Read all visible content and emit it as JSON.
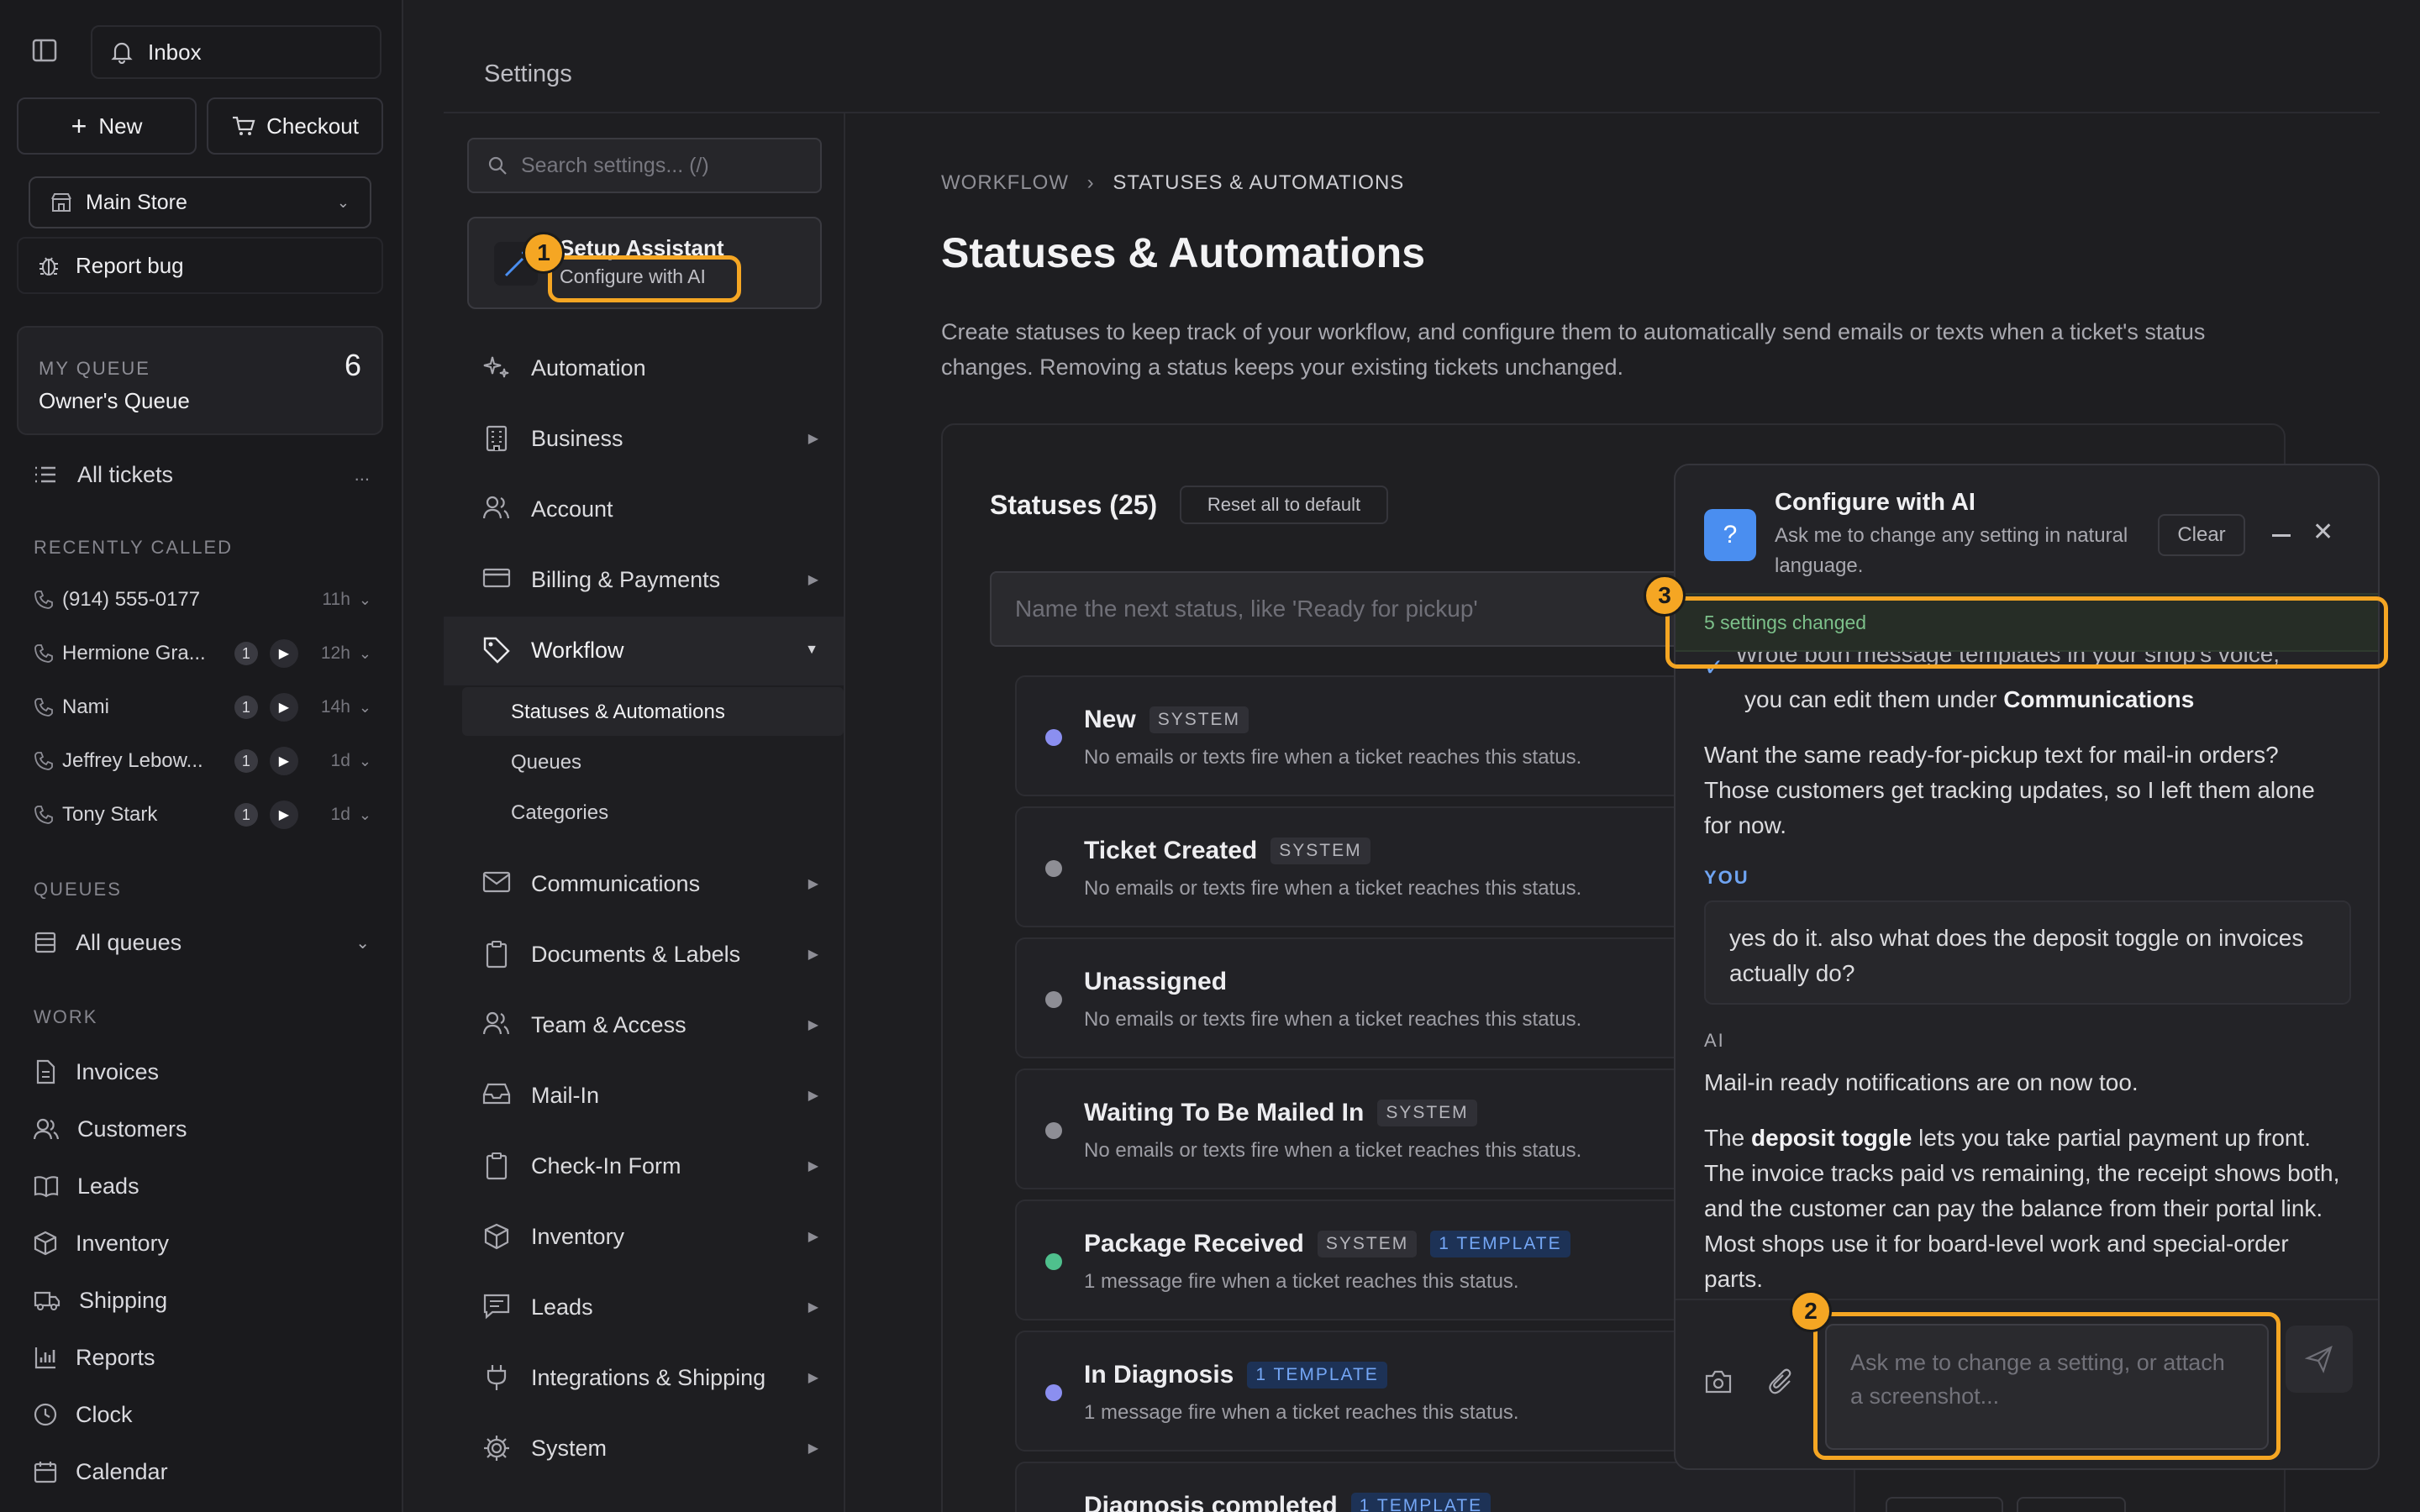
{
  "sidebar": {
    "inbox": "Inbox",
    "new_label": "New",
    "checkout_label": "Checkout",
    "store": "Main Store",
    "report_bug": "Report bug",
    "my_queue_label": "MY QUEUE",
    "my_queue_name": "Owner's Queue",
    "my_queue_count": "6",
    "all_tickets": "All tickets",
    "all_tickets_more": "...",
    "recently_called_label": "RECENTLY CALLED",
    "calls": [
      {
        "name": "(914) 555-0177",
        "badge": "",
        "time": "11h"
      },
      {
        "name": "Hermione Gra...",
        "badge": "1",
        "time": "12h"
      },
      {
        "name": "Nami",
        "badge": "1",
        "time": "14h"
      },
      {
        "name": "Jeffrey Lebow...",
        "badge": "1",
        "time": "1d"
      },
      {
        "name": "Tony Stark",
        "badge": "1",
        "time": "1d"
      }
    ],
    "queues_label": "QUEUES",
    "all_queues": "All queues",
    "work_label": "WORK",
    "work_items": [
      "Invoices",
      "Customers",
      "Leads",
      "Inventory",
      "Shipping",
      "Reports",
      "Clock",
      "Calendar"
    ]
  },
  "settings": {
    "title": "Settings",
    "search_placeholder": "Search settings... (/)",
    "setup_title": "Setup Assistant",
    "setup_sub": "Configure with AI",
    "menu": [
      "Automation",
      "Business",
      "Account",
      "Billing & Payments",
      "Workflow",
      "Communications",
      "Documents & Labels",
      "Team & Access",
      "Mail-In",
      "Check-In Form",
      "Inventory",
      "Leads",
      "Integrations & Shipping",
      "System"
    ],
    "workflow_sub": [
      "Statuses & Automations",
      "Queues",
      "Categories"
    ]
  },
  "main": {
    "crumb_1": "WORKFLOW",
    "crumb_sep": "›",
    "crumb_2": "STATUSES & AUTOMATIONS",
    "title": "Statuses & Automations",
    "description": "Create statuses to keep track of your workflow, and configure them to automatically send emails or texts when a ticket's status changes. Removing a status keeps your existing tickets unchanged.",
    "statuses_title": "Statuses (25)",
    "reset_label": "Reset all to default",
    "new_status_placeholder": "Name the next status, like 'Ready for pickup'",
    "statuses": [
      {
        "name": "New",
        "tag": "SYSTEM",
        "tpl": "",
        "desc": "No emails or texts fire when a ticket reaches this status.",
        "color": "#8b8ff0"
      },
      {
        "name": "Ticket Created",
        "tag": "SYSTEM",
        "tpl": "",
        "desc": "No emails or texts fire when a ticket reaches this status.",
        "color": "#8e8e95"
      },
      {
        "name": "Unassigned",
        "tag": "",
        "tpl": "",
        "desc": "No emails or texts fire when a ticket reaches this status.",
        "color": "#8e8e95"
      },
      {
        "name": "Waiting To Be Mailed In",
        "tag": "SYSTEM",
        "tpl": "",
        "desc": "No emails or texts fire when a ticket reaches this status.",
        "color": "#8e8e95"
      },
      {
        "name": "Package Received",
        "tag": "SYSTEM",
        "tpl": "1 TEMPLATE",
        "desc": "1 message fire when a ticket reaches this status.",
        "color": "#4fc08d"
      },
      {
        "name": "In Diagnosis",
        "tag": "",
        "tpl": "1 TEMPLATE",
        "desc": "1 message fire when a ticket reaches this status.",
        "color": "#8b8ff0"
      },
      {
        "name": "Diagnosis completed",
        "tag": "",
        "tpl": "1 TEMPLATE",
        "desc": "",
        "color": "#8e8e95"
      }
    ]
  },
  "ai_panel": {
    "title": "Configure with AI",
    "subtitle": "Ask me to change any setting in natural language.",
    "clear_label": "Clear",
    "settings_changed": "5 settings changed",
    "partial_line": "Wrote both message templates in your shop's voice,",
    "edit_line_pre": "you can edit them under ",
    "edit_line_bold": "Communications",
    "question": "Want the same ready-for-pickup text for mail-in orders? Those customers get tracking updates, so I left them alone for now.",
    "you_label": "YOU",
    "user_message": "yes do it. also what does the deposit toggle on invoices actually do?",
    "ai_label": "AI",
    "reply_1": "Mail-in ready notifications are on now too.",
    "reply_2_pre": "The ",
    "reply_2_bold": "deposit toggle",
    "reply_2_post": " lets you take partial payment up front. The invoice tracks paid vs remaining, the receipt shows both, and the customer can pay the balance from their portal link. Most shops use it for board-level work and special-order parts.",
    "input_placeholder": "Ask me to change a setting, or attach a screenshot..."
  },
  "annotations": [
    "1",
    "2",
    "3"
  ],
  "colors": {
    "accent": "#4a8ef0",
    "annotation": "#f5a623",
    "success": "#7cc08a"
  }
}
